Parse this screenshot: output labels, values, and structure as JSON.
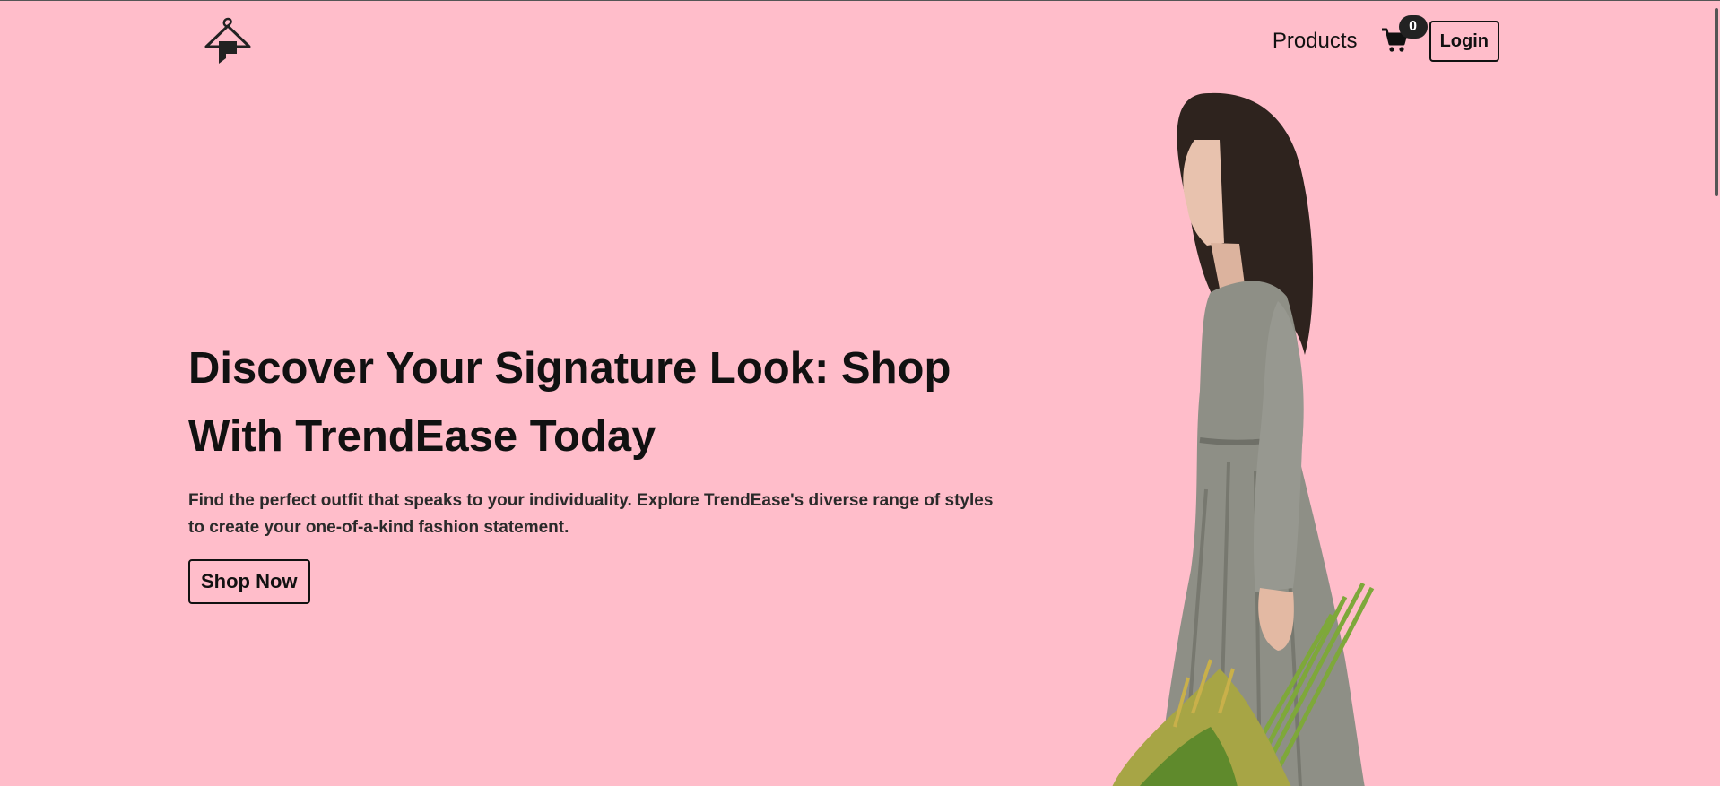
{
  "nav": {
    "logo_icon": "hanger-logo-icon",
    "products_label": "Products",
    "cart_icon": "shopping-cart-icon",
    "cart_count": "0",
    "login_label": "Login"
  },
  "hero": {
    "title": "Discover Your Signature Look: Shop With TrendEase Today",
    "subtitle": "Find the perfect outfit that speaks to your individuality. Explore TrendEase's diverse range of styles to create your one-of-a-kind fashion statement.",
    "cta_label": "Shop Now"
  },
  "colors": {
    "background": "#ffbdca",
    "text": "#111111",
    "badge": "#222222"
  }
}
